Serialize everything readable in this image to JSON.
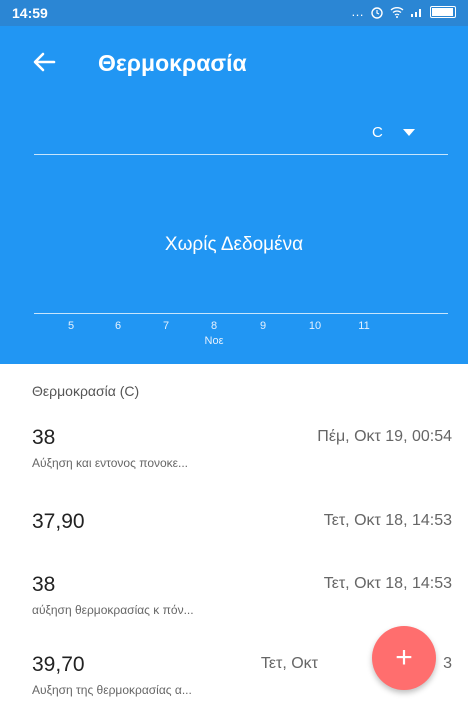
{
  "status_bar": {
    "time": "14:59",
    "icons": [
      "more-icon",
      "alarm-icon",
      "wifi-icon",
      "signal-icon",
      "battery-icon"
    ]
  },
  "header": {
    "title": "Θερμοκρασία",
    "unit_selected": "C",
    "empty_text": "Χωρίς Δεδομένα",
    "x_ticks": [
      "5",
      "6",
      "7",
      "8",
      "9",
      "10",
      "11"
    ],
    "month_label": "Νοε",
    "color": "#2196f3"
  },
  "list": {
    "section_label": "Θερμοκρασία (C)",
    "items": [
      {
        "value": "38",
        "date": "Πέμ, Οκτ 19, 00:54",
        "note": "Αύξηση και εντονος πονοκε..."
      },
      {
        "value": "37,90",
        "date": "Τετ, Οκτ 18, 14:53",
        "note": ""
      },
      {
        "value": "38",
        "date": "Τετ, Οκτ 18, 14:53",
        "note": "αύξηση θερμοκρασίας κ πόν..."
      },
      {
        "value": "39,70",
        "date": "Τετ, Οκτ",
        "date_tail": "3",
        "note": "Αυξηση της θερμοκρασίας α..."
      }
    ]
  },
  "fab": {
    "label": "+",
    "color": "#ff6e6e"
  }
}
